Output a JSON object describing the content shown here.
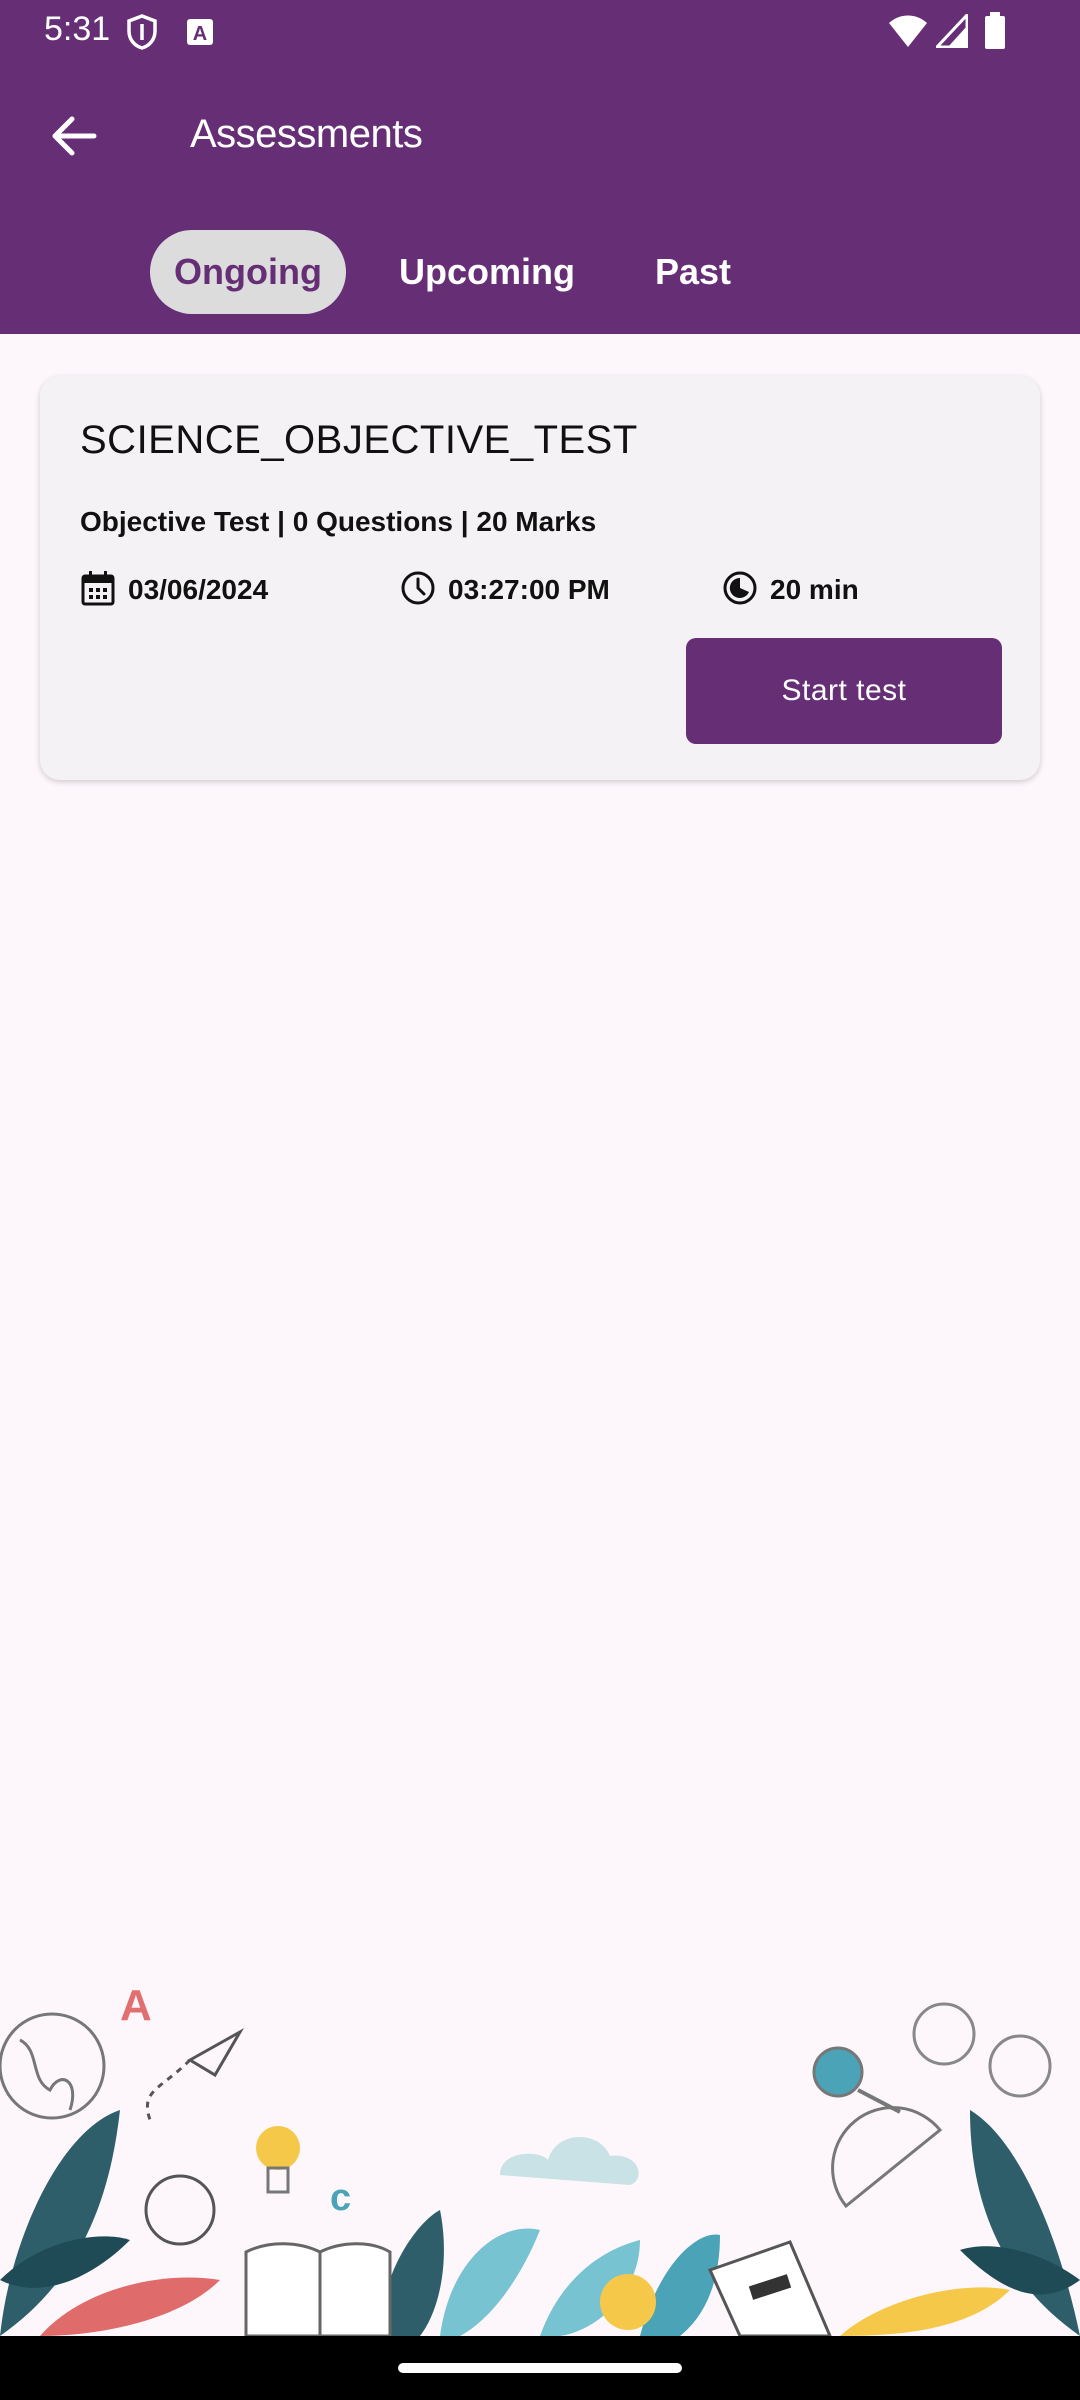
{
  "status_bar": {
    "time": "5:31",
    "icons": [
      "shield-icon",
      "text-a-icon",
      "wifi-icon",
      "signal-icon",
      "battery-icon"
    ]
  },
  "app_bar": {
    "title": "Assessments",
    "back_icon": "arrow-left-icon",
    "background": "#652e75"
  },
  "tabs": [
    {
      "label": "Ongoing",
      "active": true
    },
    {
      "label": "Upcoming",
      "active": false
    },
    {
      "label": "Past",
      "active": false
    }
  ],
  "assessment_card": {
    "title": "SCIENCE_OBJECTIVE_TEST",
    "subtitle": "Objective Test | 0 Questions | 20 Marks",
    "date": "03/06/2024",
    "time": "03:27:00 PM",
    "duration": "20 min",
    "start_button_label": "Start test"
  },
  "colors": {
    "primary": "#652e75",
    "page_background": "#fdf7fc",
    "card_background": "#f5f2f6",
    "active_tab_background": "#dcdcdc"
  }
}
